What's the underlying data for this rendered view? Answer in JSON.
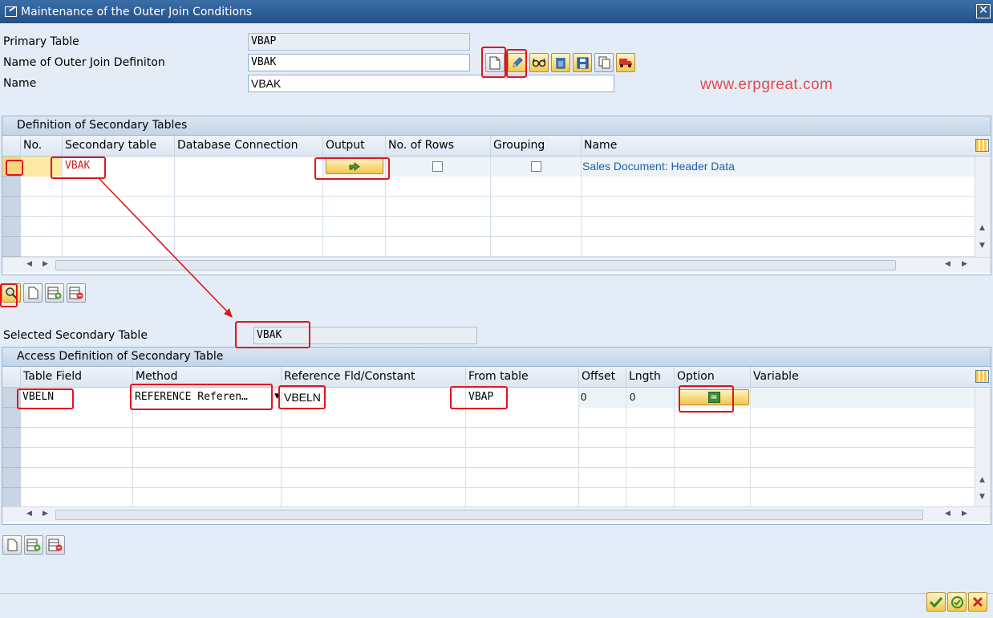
{
  "window": {
    "title": "Maintenance of the Outer Join Conditions"
  },
  "header_fields": {
    "primary_table_label": "Primary Table",
    "primary_table_value": "VBAP",
    "outer_join_label": "Name of Outer Join Definiton",
    "outer_join_value": "VBAK",
    "name_label": "Name",
    "name_value": "VBAK"
  },
  "toolbar_icons": [
    "new-document-icon",
    "pencil-icon",
    "glasses-icon",
    "trash-icon",
    "save-icon",
    "copy-icon",
    "transport-truck-icon"
  ],
  "watermark": "www.erpgreat.com",
  "secondary_tables": {
    "title": "Definition of Secondary Tables",
    "columns": [
      "No.",
      "Secondary table",
      "Database Connection",
      "Output",
      "No. of Rows",
      "Grouping",
      "Name"
    ],
    "rows": [
      {
        "no": "",
        "secondary_table": "VBAK",
        "database_connection": "",
        "name": "Sales Document: Header Data"
      }
    ]
  },
  "selected_secondary": {
    "label": "Selected Secondary Table",
    "value": "VBAK"
  },
  "access_definition": {
    "title": "Access Definition of Secondary Table",
    "columns": [
      "Table Field",
      "Method",
      "Reference Fld/Constant",
      "From table",
      "Offset",
      "Lngth",
      "Option",
      "Variable"
    ],
    "rows": [
      {
        "table_field": "VBELN",
        "method": "REFERENCE Referen…",
        "reference": "VBELN",
        "from_table": "VBAP",
        "offset": "0",
        "length": "0",
        "variable": ""
      }
    ]
  },
  "colors": {
    "accent_red": "#e0141f",
    "title_blue": "#2a5a93",
    "link_blue": "#1f5fa8"
  }
}
